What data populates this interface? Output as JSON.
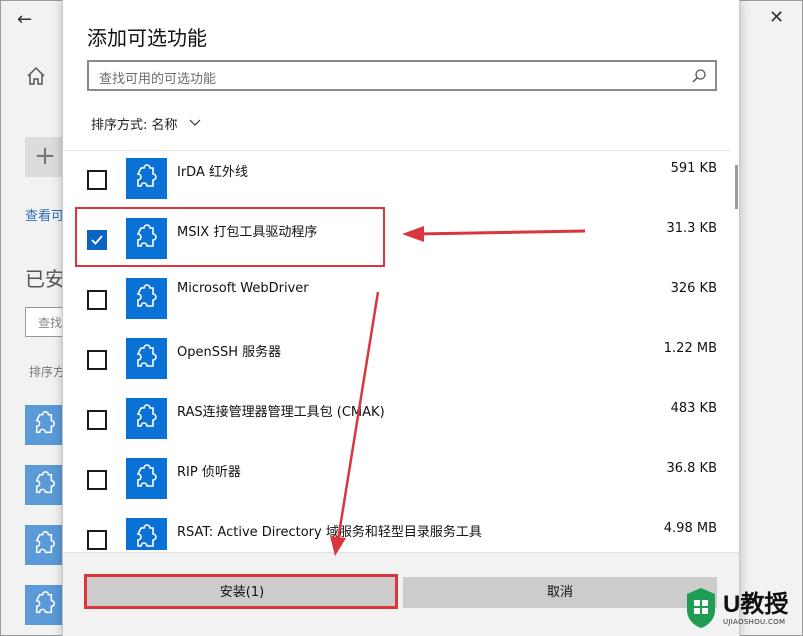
{
  "background": {
    "back_glyph": "←",
    "home_icon": "home-icon",
    "add_glyph": "+",
    "link_text": "查看可",
    "heading": "已安",
    "search_placeholder": "查找",
    "sort_label": "排序方",
    "window_controls": {
      "close_glyph": "✕"
    }
  },
  "dialog": {
    "title": "添加可选功能",
    "search": {
      "placeholder": "查找可用的可选功能",
      "icon": "search-icon"
    },
    "sort": {
      "label": "排序方式:",
      "value": "名称",
      "icon": "chevron-down-icon"
    },
    "items": [
      {
        "name": "IrDA 红外线",
        "size": "591 KB",
        "checked": false
      },
      {
        "name": "MSIX 打包工具驱动程序",
        "size": "31.3 KB",
        "checked": true
      },
      {
        "name": "Microsoft WebDriver",
        "size": "326 KB",
        "checked": false
      },
      {
        "name": "OpenSSH 服务器",
        "size": "1.22 MB",
        "checked": false
      },
      {
        "name": "RAS连接管理器管理工具包 (CMAK)",
        "size": "483 KB",
        "checked": false
      },
      {
        "name": "RIP 侦听器",
        "size": "36.8 KB",
        "checked": false
      },
      {
        "name": "RSAT: Active Directory 域服务和轻型目录服务工具",
        "size": "4.98 MB",
        "checked": false
      }
    ],
    "buttons": {
      "install": "安装(1)",
      "cancel": "取消"
    }
  },
  "watermark": {
    "brand": "U教授",
    "url": "UJIAOSHOU.COM"
  },
  "colors": {
    "accent": "#0a72d6",
    "annotation": "#d9363e",
    "button_bg": "#cccccc",
    "footer_bg": "#f2f2f2"
  }
}
